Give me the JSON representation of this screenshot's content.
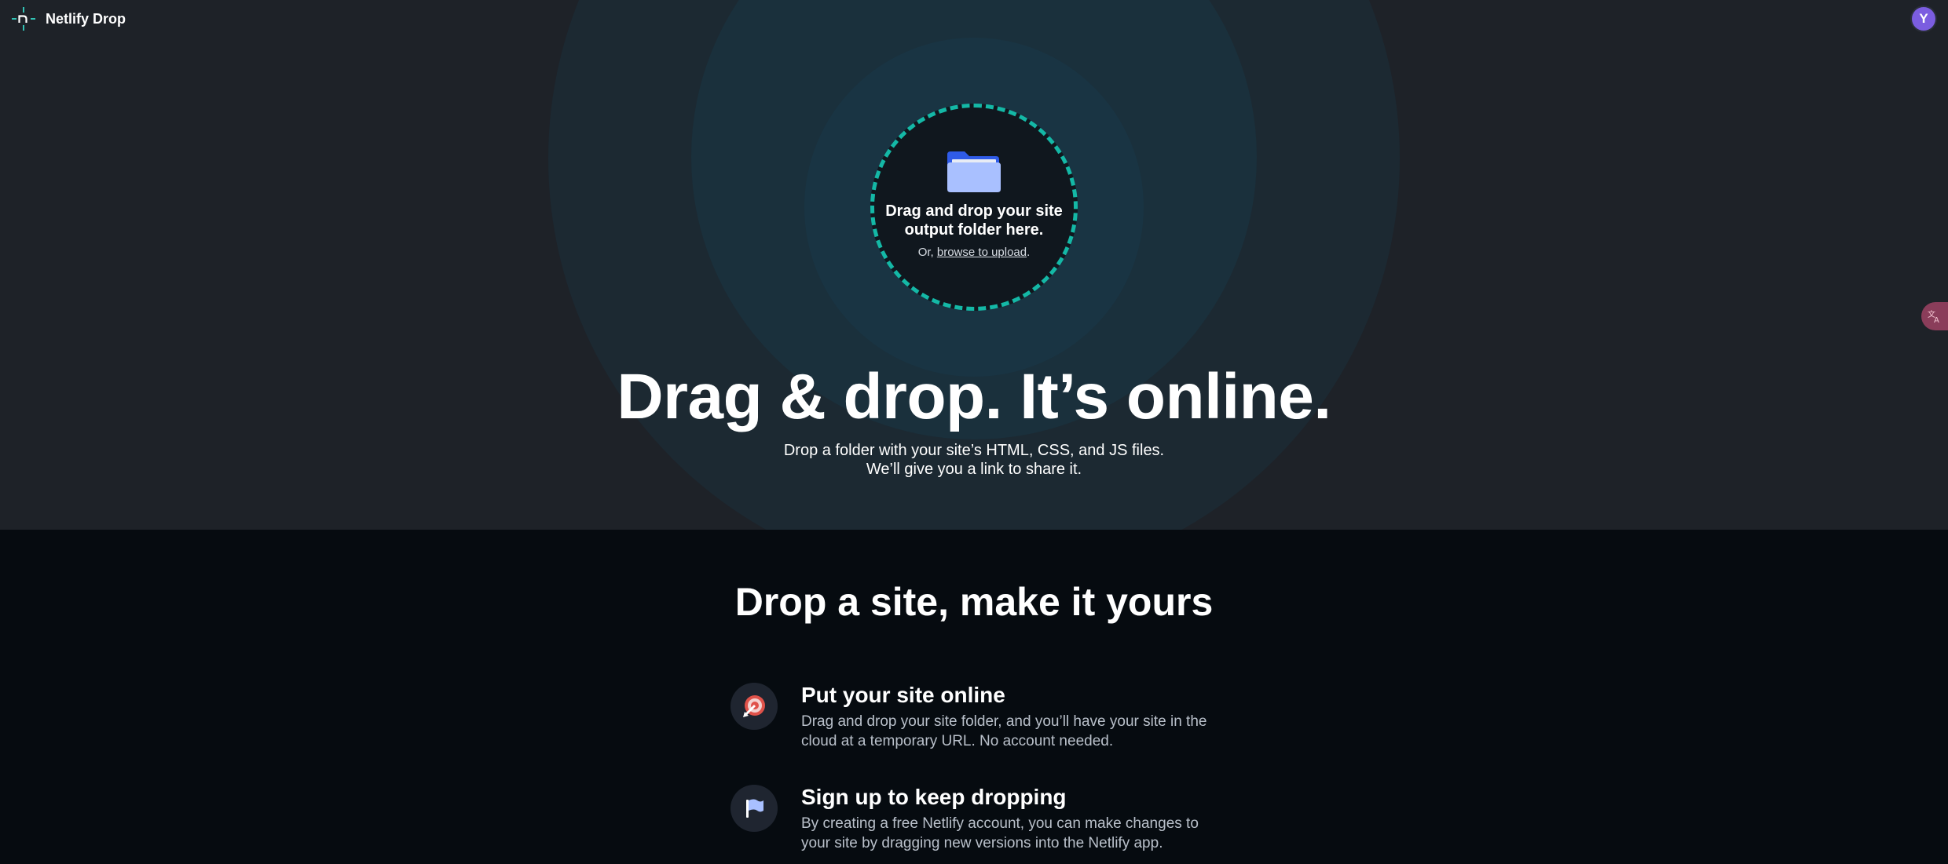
{
  "app": {
    "brand": "Netlify Drop",
    "avatar_initial": "Y"
  },
  "dropzone": {
    "title": "Drag and drop your site output folder here.",
    "sub_prefix": "Or, ",
    "browse_link": "browse to upload",
    "sub_suffix": "."
  },
  "hero": {
    "headline": "Drag & drop. It’s online.",
    "line1": "Drop a folder with your site’s HTML, CSS, and JS files.",
    "line2": "We’ll give you a link to share it."
  },
  "section": {
    "title": "Drop a site, make it yours",
    "features": [
      {
        "title": "Put your site online",
        "description": "Drag and drop your site folder, and you’ll have your site in the cloud at a temporary URL. No account needed.",
        "icon": "target-arrow-icon"
      },
      {
        "title": "Sign up to keep dropping",
        "description": "By creating a free Netlify account, you can make changes to your site by dragging new versions into the Netlify app.",
        "icon": "flag-icon"
      }
    ]
  },
  "colors": {
    "accent_teal": "#14b8a6",
    "avatar_purple": "#7b5de0",
    "folder_blue": "#2f5be8",
    "target_red": "#e0524a"
  }
}
